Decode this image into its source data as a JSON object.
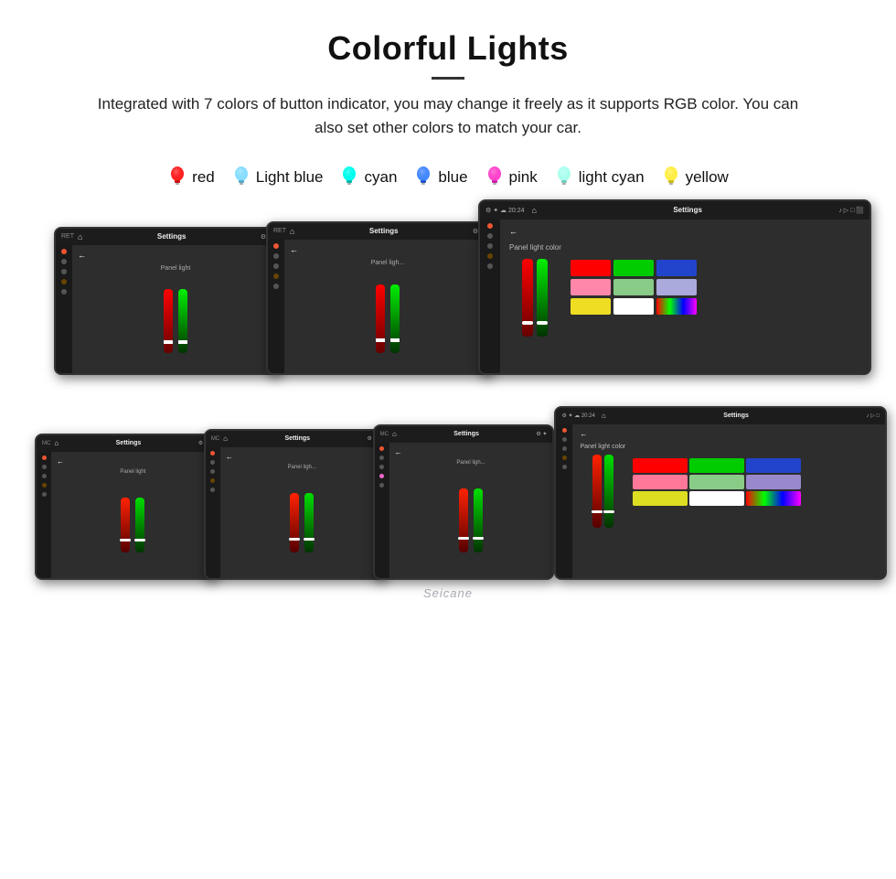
{
  "header": {
    "title": "Colorful Lights",
    "description": "Integrated with 7 colors of button indicator, you may change it freely as it supports RGB color. You can also set other colors to match your car."
  },
  "colors": [
    {
      "name": "red",
      "color": "#ff2020",
      "icon": "bulb"
    },
    {
      "name": "Light blue",
      "color": "#88ddff",
      "icon": "bulb"
    },
    {
      "name": "cyan",
      "color": "#00ffee",
      "icon": "bulb"
    },
    {
      "name": "blue",
      "color": "#4488ff",
      "icon": "bulb"
    },
    {
      "name": "pink",
      "color": "#ff44cc",
      "icon": "bulb"
    },
    {
      "name": "light cyan",
      "color": "#aaffee",
      "icon": "bulb"
    },
    {
      "name": "yellow",
      "color": "#ffee44",
      "icon": "bulb"
    }
  ],
  "screens": {
    "settings_label": "Settings",
    "panel_light": "Panel light",
    "panel_light_color": "Panel light color",
    "back": "←",
    "time": "20:24"
  },
  "watermark": "Seicane"
}
